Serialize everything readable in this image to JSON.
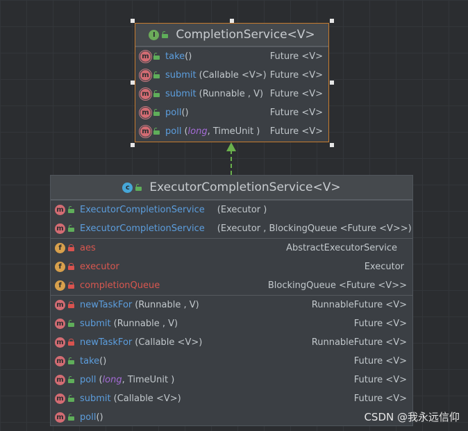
{
  "interface_box": {
    "title": "CompletionService<V>",
    "methods": [
      {
        "name": "take",
        "params": "()",
        "type": "Future <V>"
      },
      {
        "name": "submit",
        "params": "(Callable <V>)",
        "type": "Future <V>"
      },
      {
        "name": "submit",
        "params": "(Runnable , V)",
        "type": "Future <V>"
      },
      {
        "name": "poll",
        "params": "()",
        "type": "Future <V>"
      },
      {
        "name": "poll",
        "params_open": "(",
        "params_kw": "long",
        "params_rest": ", TimeUnit )",
        "type": "Future <V>"
      }
    ]
  },
  "class_box": {
    "title": "ExecutorCompletionService<V>",
    "constructors": [
      {
        "name": "ExecutorCompletionService",
        "params": "(Executor )"
      },
      {
        "name": "ExecutorCompletionService",
        "params": "(Executor , BlockingQueue <Future <V>>)"
      }
    ],
    "fields": [
      {
        "name": "aes",
        "type": "AbstractExecutorService"
      },
      {
        "name": "executor",
        "type": "Executor"
      },
      {
        "name": "completionQueue",
        "type": "BlockingQueue <Future <V>>"
      }
    ],
    "methods": [
      {
        "name": "newTaskFor",
        "params": "(Runnable , V)",
        "type": "RunnableFuture <V>"
      },
      {
        "name": "submit",
        "params": "(Runnable , V)",
        "type": "Future <V>"
      },
      {
        "name": "newTaskFor",
        "params": "(Callable <V>)",
        "type": "RunnableFuture <V>"
      },
      {
        "name": "take",
        "params": "()",
        "type": "Future <V>"
      },
      {
        "name": "poll",
        "params_open": "(",
        "params_kw": "long",
        "params_rest": ", TimeUnit )",
        "type": "Future <V>"
      },
      {
        "name": "submit",
        "params": "(Callable <V>)",
        "type": "Future <V>"
      },
      {
        "name": "poll",
        "params": "()",
        "type": "Future <V>"
      }
    ]
  },
  "icons": {
    "method": "m",
    "field": "f",
    "interface": "I",
    "class": "c"
  },
  "watermark": "CSDN @我永远信仰",
  "colors": {
    "background": "#2b2d30",
    "box": "#3b3f44",
    "method_name": "#5c9ede",
    "field_name": "#d9574f",
    "keyword": "#a46bd6",
    "implements_arrow": "#6ab04c",
    "selection_border": "#c77c2f"
  }
}
